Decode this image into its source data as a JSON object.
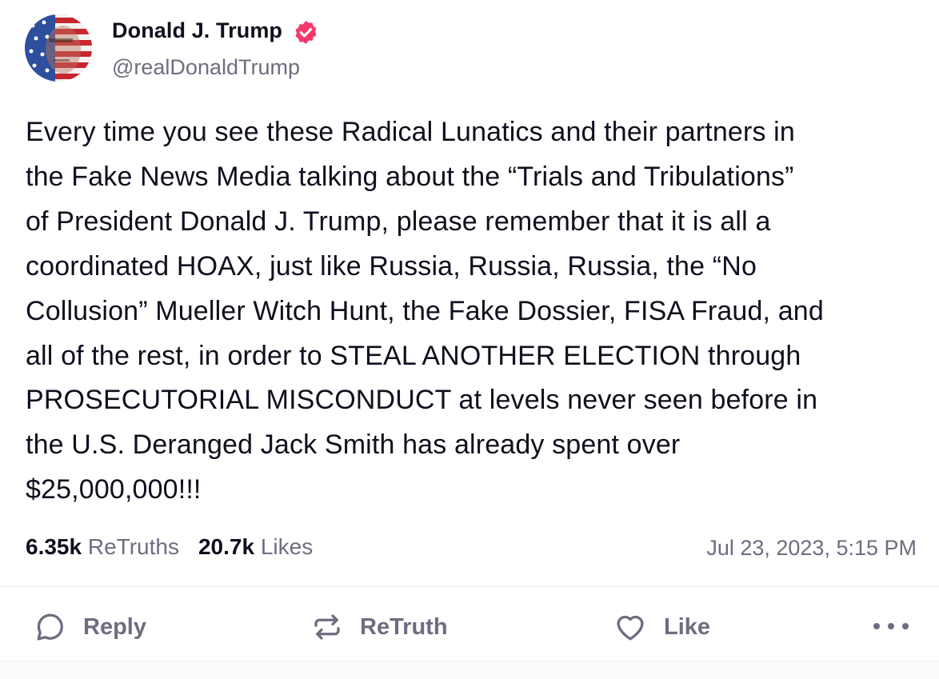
{
  "author": {
    "display_name": "Donald J. Trump",
    "handle": "@realDonaldTrump",
    "verified_icon": "verified-badge-icon",
    "verified_color": "#f5386a"
  },
  "post": {
    "text": "Every time you see these Radical Lunatics and their partners in\nthe Fake News Media talking about the “Trials and Tribulations”\nof President Donald J. Trump, please remember that it is all a\ncoordinated HOAX, just like Russia, Russia, Russia, the “No\nCollusion” Mueller Witch Hunt, the Fake Dossier, FISA Fraud, and\nall of the rest, in order to STEAL ANOTHER ELECTION through\nPROSECUTORIAL MISCONDUCT at levels never seen before in\nthe U.S. Deranged Jack Smith has already spent over\n$25,000,000!!!",
    "retruths_count": "6.35k",
    "retruths_label": "ReTruths",
    "likes_count": "20.7k",
    "likes_label": "Likes",
    "timestamp": "Jul 23, 2023, 5:15 PM"
  },
  "actions": {
    "reply_label": "Reply",
    "retruth_label": "ReTruth",
    "like_label": "Like",
    "more_icon": "more-dots-icon"
  },
  "colors": {
    "text_primary": "#0f0f1e",
    "text_secondary": "#6d6d80",
    "divider": "#e6e6ec"
  }
}
